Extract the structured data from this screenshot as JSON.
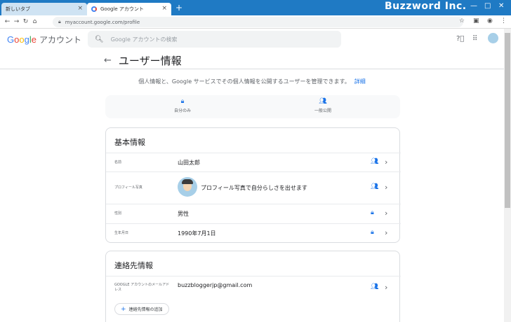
{
  "browser": {
    "tabs": [
      {
        "label": "新しいタブ",
        "close": "×"
      },
      {
        "label": "Google アカウント",
        "close": "×"
      }
    ],
    "new_tab": "+",
    "brand": "Buzzword Inc.",
    "window_controls": [
      "—",
      "□",
      "✕"
    ],
    "url": "myaccount.google.com/profile"
  },
  "header": {
    "logo": {
      "g": "G",
      "o1": "o",
      "o2": "o",
      "g2": "g",
      "l": "l",
      "e": "e",
      "suffix": "アカウント"
    },
    "search_placeholder": "Google アカウントの検索"
  },
  "page": {
    "title": "ユーザー情報",
    "intro": "個人情報と、Google サービスでその個人情報を公開するユーザーを管理できます。",
    "intro_link": "詳細",
    "legend": [
      {
        "icon": "lock-icon",
        "label": "自分のみ"
      },
      {
        "icon": "people-icon",
        "label": "一般公開"
      }
    ]
  },
  "basic": {
    "title": "基本情報",
    "rows": [
      {
        "label": "名前",
        "value": "山田太郎",
        "visibility": "people-icon"
      },
      {
        "label": "プロフィール写真",
        "value": "プロフィール写真で自分らしさを出せます",
        "visibility": "people-icon"
      },
      {
        "label": "性別",
        "value": "男性",
        "visibility": "lock-icon"
      },
      {
        "label": "生年月日",
        "value": "1990年7月1日",
        "visibility": "lock-icon"
      }
    ]
  },
  "contact": {
    "title": "連絡先情報",
    "rows": [
      {
        "label": "GOOGLE アカウントのメールアドレス",
        "value": "buzzbloggerjp@gmail.com",
        "visibility": "people-icon"
      }
    ],
    "add_button": "連絡先情報の追加"
  }
}
